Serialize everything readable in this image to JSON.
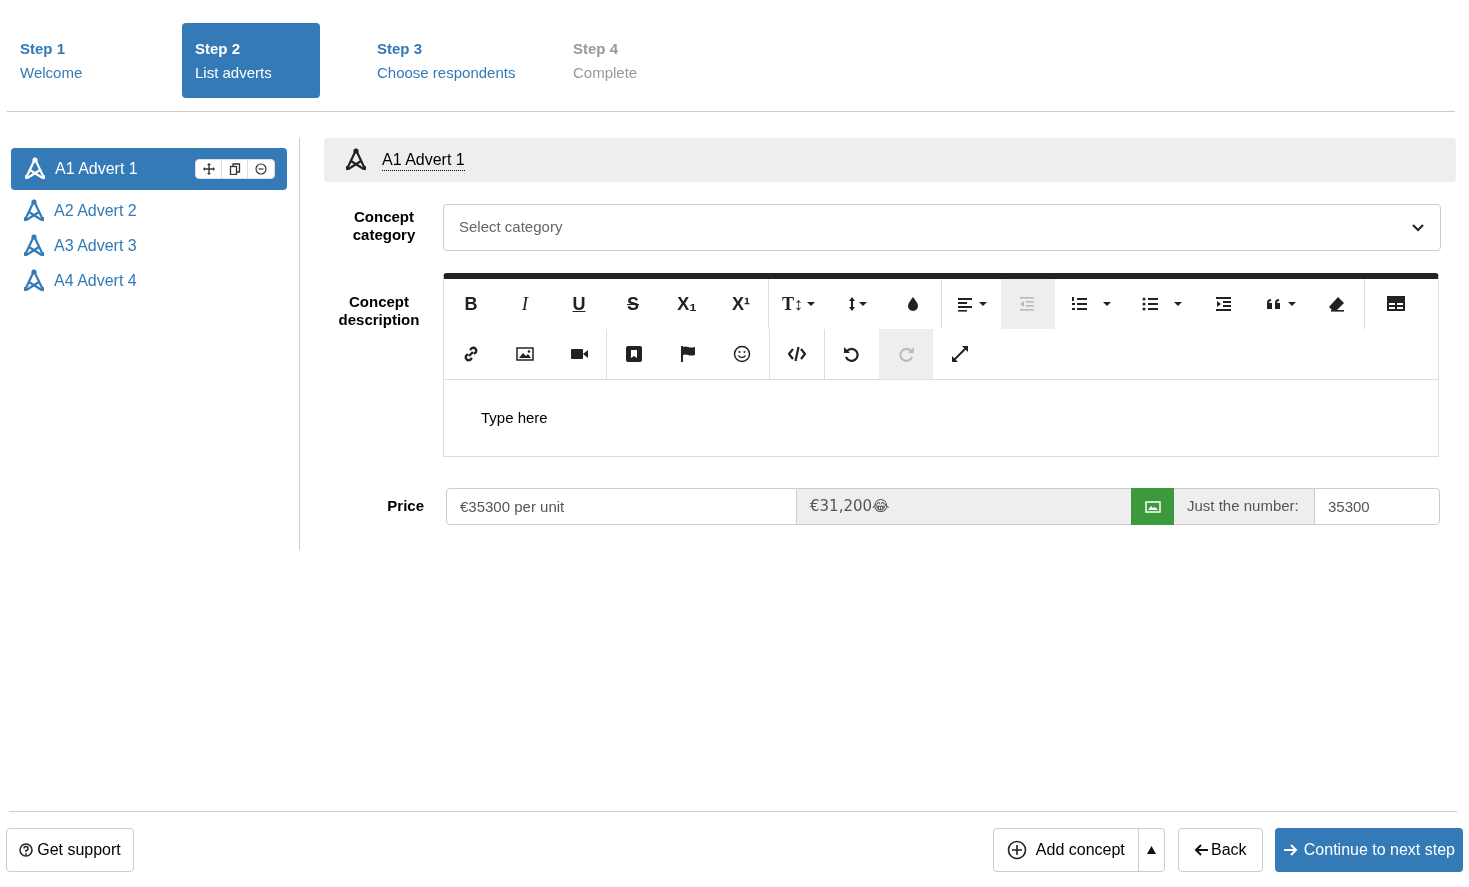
{
  "steps": [
    {
      "number": "Step 1",
      "label": "Welcome",
      "selected": false,
      "disabled": false
    },
    {
      "number": "Step 2",
      "label": "List adverts",
      "selected": true,
      "disabled": false
    },
    {
      "number": "Step 3",
      "label": "Choose respondents",
      "selected": false,
      "disabled": false
    },
    {
      "number": "Step 4",
      "label": "Complete",
      "selected": false,
      "disabled": true
    }
  ],
  "sidebar": {
    "items": [
      {
        "label": "A1 Advert 1",
        "selected": true
      },
      {
        "label": "A2 Advert 2",
        "selected": false
      },
      {
        "label": "A3 Advert 3",
        "selected": false
      },
      {
        "label": "A4 Advert 4",
        "selected": false
      }
    ]
  },
  "panel": {
    "title": "A1 Advert 1",
    "category": {
      "label": "Concept category",
      "placeholder": "Select category"
    },
    "description": {
      "label": "Concept description",
      "placeholder": "Type here",
      "toolbar": [
        [
          [
            {
              "kind": "bold",
              "label": "B",
              "disabled": false
            },
            {
              "kind": "italic",
              "label": "I",
              "disabled": false
            },
            {
              "kind": "underline",
              "label": "U",
              "disabled": false
            },
            {
              "kind": "strike",
              "label": "S",
              "disabled": false
            },
            {
              "kind": "subscript",
              "label": "X₁",
              "disabled": false
            },
            {
              "kind": "superscript",
              "label": "X¹",
              "disabled": false
            }
          ],
          [
            {
              "kind": "fontsize",
              "label": "T↕",
              "disabled": false
            },
            {
              "kind": "lineheight",
              "disabled": false
            },
            {
              "kind": "color",
              "disabled": false
            }
          ],
          [
            {
              "kind": "align",
              "disabled": false
            },
            {
              "kind": "outdent",
              "disabled": true
            },
            {
              "kind": "ol",
              "disabled": false
            },
            {
              "kind": "ul",
              "disabled": false
            },
            {
              "kind": "indent",
              "disabled": false
            },
            {
              "kind": "quote",
              "disabled": false
            },
            {
              "kind": "eraser",
              "disabled": false
            }
          ],
          [
            {
              "kind": "table",
              "disabled": false
            }
          ]
        ],
        [
          [
            {
              "kind": "link",
              "disabled": false
            },
            {
              "kind": "image",
              "disabled": false
            },
            {
              "kind": "video",
              "disabled": false
            }
          ],
          [
            {
              "kind": "bookmark",
              "disabled": false
            },
            {
              "kind": "flag",
              "disabled": false
            },
            {
              "kind": "emoji",
              "disabled": false
            }
          ],
          [
            {
              "kind": "code",
              "disabled": false
            }
          ],
          [
            {
              "kind": "undo",
              "disabled": false
            },
            {
              "kind": "redo",
              "disabled": true
            },
            {
              "kind": "fullscreen",
              "disabled": false
            }
          ]
        ]
      ]
    },
    "price": {
      "label": "Price",
      "value": "€35300 per unit",
      "preview": "€31,200😂",
      "number_label": "Just the number:",
      "number": "35300"
    }
  },
  "footer": {
    "support": "Get support",
    "add": "Add concept",
    "back": "Back",
    "next": "Continue to next step"
  }
}
